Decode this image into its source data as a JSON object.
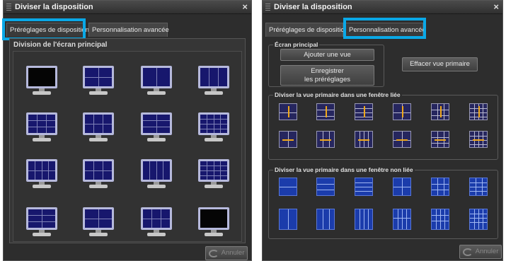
{
  "left": {
    "title": "Diviser la disposition",
    "close_glyph": "×",
    "tabs": [
      "Préréglages de disposition",
      "Personnalisation avancée"
    ],
    "active_tab": 0,
    "section_title": "Division de l'écran principal",
    "presets": [
      {
        "name": "1x1"
      },
      {
        "name": "1+3"
      },
      {
        "name": "1x2"
      },
      {
        "name": "1x3"
      },
      {
        "name": "3x3"
      },
      {
        "name": "3x3b"
      },
      {
        "name": "3x3c"
      },
      {
        "name": "4x4"
      },
      {
        "name": "4x3"
      },
      {
        "name": "4x3b"
      },
      {
        "name": "4x2"
      },
      {
        "name": "4x4b"
      },
      {
        "name": "1+5"
      },
      {
        "name": "1+7"
      },
      {
        "name": "1+8"
      },
      {
        "name": "blank"
      }
    ],
    "undo_label": "Annuler",
    "highlight_color": "#0aa8e6"
  },
  "right": {
    "title": "Diviser la disposition",
    "close_glyph": "×",
    "tabs": [
      "Préréglages de disposition",
      "Personnalisation avancée"
    ],
    "active_tab": 1,
    "ecran_group": "Écran principal",
    "add_view": "Ajouter une vue",
    "save_presets_line1": "Enregistrer",
    "save_presets_line2": "les préréglages",
    "clear_primary": "Effacer vue primaire",
    "linked_group": "Diviser la vue primaire dans une fenêtre liée",
    "unlinked_group": "Diviser la vue primaire dans une fenêtre non liée",
    "undo_label": "Annuler"
  }
}
